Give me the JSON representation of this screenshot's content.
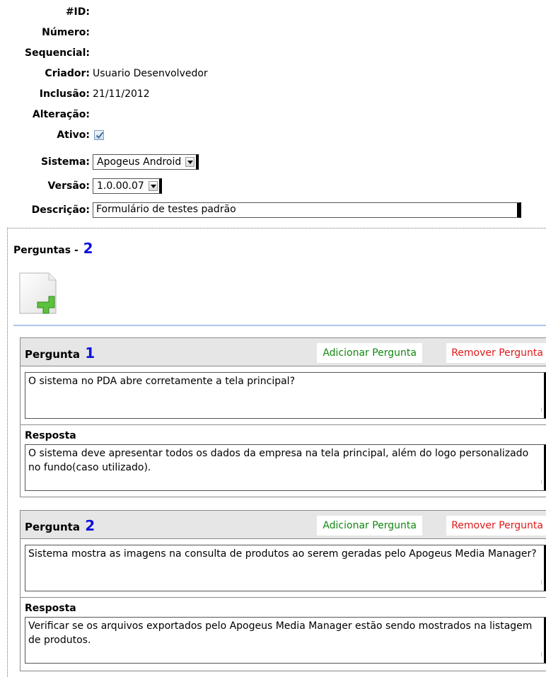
{
  "form": {
    "id_label": "#ID:",
    "numero_label": "Número:",
    "sequencial_label": "Sequencial:",
    "criador_label": "Criador:",
    "criador_value": "Usuario Desenvolvedor",
    "inclusao_label": "Inclusão:",
    "inclusao_value": "21/11/2012",
    "alteracao_label": "Alteração:",
    "ativo_label": "Ativo:",
    "ativo_checked": true,
    "sistema_label": "Sistema:",
    "sistema_value": "Apogeus Android",
    "versao_label": "Versão:",
    "versao_value": "1.0.00.07",
    "descricao_label": "Descrição:",
    "descricao_value": "Formulário de testes padrão"
  },
  "perguntas": {
    "title": "Perguntas -",
    "count": "2",
    "add_icon": "add-document-icon",
    "items": [
      {
        "label": "Pergunta",
        "number": "1",
        "add_label": "Adicionar Pergunta",
        "remove_label": "Remover Pergunta",
        "question": "O sistema no PDA abre corretamente a tela principal?",
        "answer_label": "Resposta",
        "answer": "O sistema deve apresentar todos os dados da empresa na tela principal, além do logo personalizado no fundo(caso utilizado)."
      },
      {
        "label": "Pergunta",
        "number": "2",
        "add_label": "Adicionar Pergunta",
        "remove_label": "Remover Pergunta",
        "question": "Sistema mostra as imagens na consulta de produtos ao serem geradas pelo Apogeus Media Manager?",
        "answer_label": "Resposta",
        "answer": "Verificar se os arquivos exportados pelo Apogeus Media Manager estão sendo mostrados na listagem de produtos."
      }
    ]
  },
  "colors": {
    "add_button": "#118811",
    "remove_button": "#e01818",
    "count_number": "#1010e0",
    "question_header_bg": "#e6e6e6",
    "divider": "#a9c9ea"
  }
}
